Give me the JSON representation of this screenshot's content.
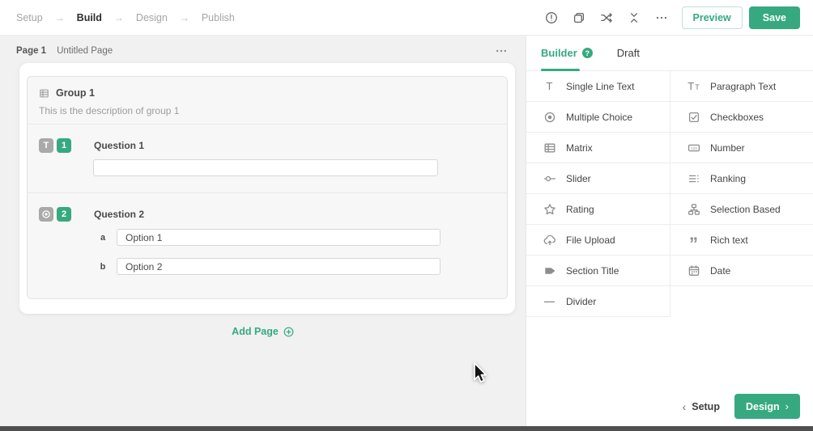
{
  "topbar": {
    "steps": [
      {
        "label": "Setup",
        "active": false
      },
      {
        "label": "Build",
        "active": true
      },
      {
        "label": "Design",
        "active": false
      },
      {
        "label": "Publish",
        "active": false
      }
    ],
    "step_arrow": "→",
    "icons": [
      "alert-circle-icon",
      "duplicate-icon",
      "shuffle-icon",
      "collapse-vertical-icon",
      "ellipsis-icon"
    ],
    "preview_label": "Preview",
    "save_label": "Save"
  },
  "canvas": {
    "page_label": "Page 1",
    "page_title": "Untitled Page",
    "head_menu_icon": "ellipsis-icon",
    "group": {
      "icon": "group-icon",
      "title": "Group 1",
      "description": "This is the description of group 1"
    },
    "questions": [
      {
        "type_icon": "text-type-icon",
        "type_glyph": "T",
        "number": "1",
        "title": "Question 1",
        "input_value": ""
      },
      {
        "type_icon": "radio-type-icon",
        "number": "2",
        "title": "Question 2",
        "options": [
          {
            "key": "a",
            "value": "Option 1"
          },
          {
            "key": "b",
            "value": "Option 2"
          }
        ]
      }
    ],
    "add_page_label": "Add Page"
  },
  "sidebar": {
    "tabs": [
      {
        "label": "Builder",
        "active": true,
        "help_icon": "help-circle-icon",
        "help_glyph": "?"
      },
      {
        "label": "Draft",
        "active": false
      }
    ],
    "fields": [
      {
        "label": "Single Line Text",
        "icon": "single-line-text-icon"
      },
      {
        "label": "Paragraph Text",
        "icon": "paragraph-text-icon"
      },
      {
        "label": "Multiple Choice",
        "icon": "multiple-choice-icon"
      },
      {
        "label": "Checkboxes",
        "icon": "checkboxes-icon"
      },
      {
        "label": "Matrix",
        "icon": "matrix-icon"
      },
      {
        "label": "Number",
        "icon": "number-icon"
      },
      {
        "label": "Slider",
        "icon": "slider-icon"
      },
      {
        "label": "Ranking",
        "icon": "ranking-icon"
      },
      {
        "label": "Rating",
        "icon": "rating-icon"
      },
      {
        "label": "Selection Based",
        "icon": "selection-based-icon"
      },
      {
        "label": "File Upload",
        "icon": "file-upload-icon"
      },
      {
        "label": "Rich text",
        "icon": "rich-text-icon"
      },
      {
        "label": "Section Title",
        "icon": "section-title-icon"
      },
      {
        "label": "Date",
        "icon": "date-icon"
      },
      {
        "label": "Divider",
        "icon": "divider-icon"
      }
    ],
    "footer": {
      "back_label": "Setup",
      "back_chevron": "‹",
      "next_label": "Design",
      "next_chevron": "›"
    }
  },
  "colors": {
    "accent": "#36a980",
    "badge_gray": "#a9a9a9",
    "bottom_bar": "#4f4f4f"
  }
}
